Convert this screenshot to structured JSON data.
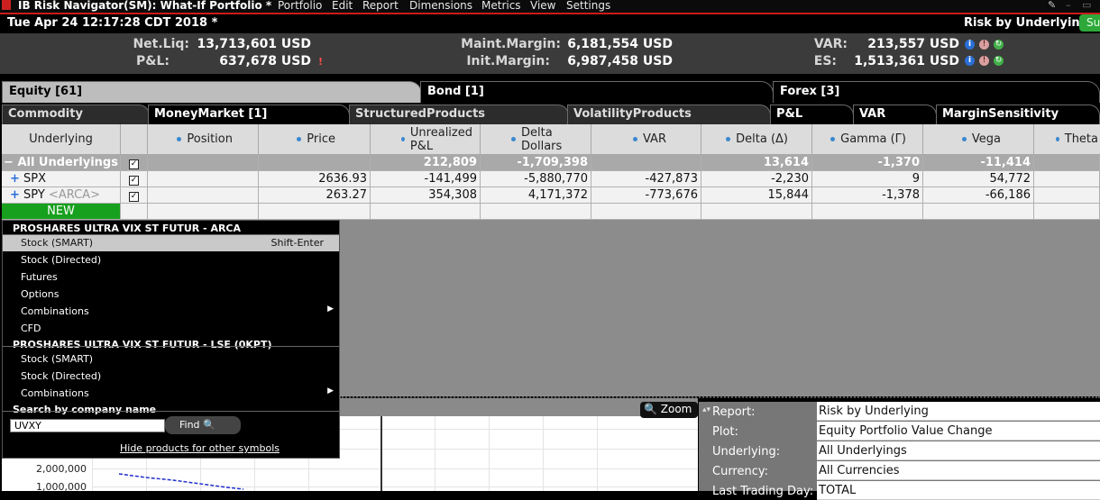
{
  "titlebar": {
    "title": "IB Risk Navigator(SM): What-If Portfolio *",
    "menu": [
      "Portfolio",
      "Edit",
      "Report",
      "Dimensions",
      "Metrics",
      "View",
      "Settings"
    ]
  },
  "status": {
    "timestamp": "Tue Apr 24 12:17:28 CDT 2018 *",
    "report_title": "Risk by Underlying",
    "green_btn": "Su"
  },
  "summary": {
    "net_liq_label": "Net.Liq:",
    "net_liq_value": "13,713,601 USD",
    "pnl_label": "P&L:",
    "pnl_value": "637,678 USD",
    "pnl_flag": "!",
    "maint_label": "Maint.Margin:",
    "maint_value": "6,181,554 USD",
    "init_label": "Init.Margin:",
    "init_value": "6,987,458 USD",
    "var_label": "VAR:",
    "var_value": "213,557 USD",
    "es_label": "ES:",
    "es_value": "1,513,361 USD"
  },
  "tabs_row1": [
    "Equity [61]",
    "Bond [1]",
    "Forex [3]"
  ],
  "tabs_row2": [
    "Commodity",
    "MoneyMarket [1]",
    "StructuredProducts",
    "VolatilityProducts",
    "P&L",
    "VAR",
    "MarginSensitivity"
  ],
  "columns": {
    "underlying": "Underlying",
    "position": "Position",
    "price": "Price",
    "unreal_1": "Unrealized",
    "unreal_2": "P&L",
    "delta_dollars_1": "Delta",
    "delta_dollars_2": "Dollars",
    "var": "VAR",
    "delta": "Delta (Δ)",
    "gamma": "Gamma (Γ)",
    "vega": "Vega",
    "theta": "Theta"
  },
  "rows": [
    {
      "prefix": "−",
      "underlying": "All Underlyings",
      "exch": "",
      "position": "",
      "price": "",
      "unreal": "212,809",
      "delta_dollars": "-1,709,398",
      "var": "",
      "delta": "13,614",
      "gamma": "-1,370",
      "vega": "-11,414",
      "theta": ""
    },
    {
      "prefix": "+",
      "underlying": "SPX",
      "exch": "",
      "position": "",
      "price": "2636.93",
      "unreal": "-141,499",
      "delta_dollars": "-5,880,770",
      "var": "-427,873",
      "delta": "-2,230",
      "gamma": "9",
      "vega": "54,772",
      "theta": ""
    },
    {
      "prefix": "+",
      "underlying": "SPY",
      "exch": "<ARCA>",
      "position": "",
      "price": "263.27",
      "unreal": "354,308",
      "delta_dollars": "4,171,372",
      "var": "-773,676",
      "delta": "15,844",
      "gamma": "-1,378",
      "vega": "-66,186",
      "theta": ""
    }
  ],
  "new_label": "NEW",
  "context_menu": {
    "header1": "PROSHARES ULTRA VIX ST FUTUR - ARCA",
    "items1": [
      "Stock (SMART)",
      "Stock (Directed)",
      "Futures",
      "Options",
      "Combinations",
      "CFD"
    ],
    "shortcut": "Shift-Enter",
    "header2": "PROSHARES ULTRA VIX ST FUTUR - LSE (0KPT)",
    "items2": [
      "Stock (SMART)",
      "Stock (Directed)",
      "Combinations"
    ],
    "search_header": "Search by company name",
    "search_value": "UVXY",
    "find_label": "Find",
    "hide_link": "Hide products for other symbols"
  },
  "zoom_label": "Zoom",
  "chart_ticks": [
    "2,000,000",
    "1,000,000"
  ],
  "report_panel": [
    {
      "label": "Report:",
      "value": "Risk by Underlying"
    },
    {
      "label": "Plot:",
      "value": "Equity Portfolio Value Change"
    },
    {
      "label": "Underlying:",
      "value": "All Underlyings"
    },
    {
      "label": "Currency:",
      "value": "All Currencies"
    },
    {
      "label": "Last Trading Day:",
      "value": "TOTAL"
    }
  ]
}
